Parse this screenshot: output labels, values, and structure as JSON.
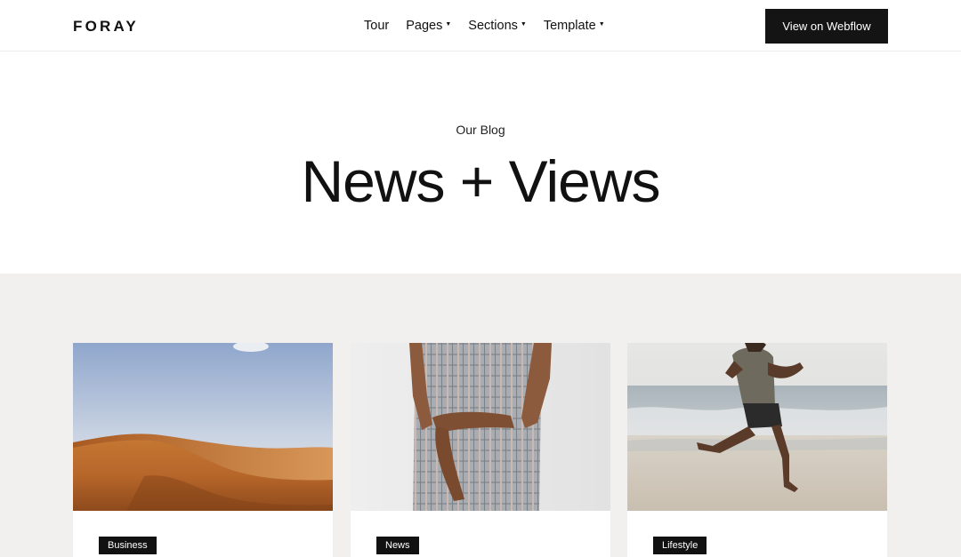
{
  "header": {
    "logo": "FORAY",
    "nav": [
      {
        "label": "Tour",
        "has_dropdown": false
      },
      {
        "label": "Pages",
        "has_dropdown": true
      },
      {
        "label": "Sections",
        "has_dropdown": true
      },
      {
        "label": "Template",
        "has_dropdown": true
      }
    ],
    "cta_label": "View on Webflow"
  },
  "hero": {
    "eyebrow": "Our Blog",
    "title": "News + Views"
  },
  "posts": [
    {
      "image": "desert-dunes-photo",
      "tag": "Business"
    },
    {
      "image": "plaid-dress-photo",
      "tag": "News"
    },
    {
      "image": "beach-runner-photo",
      "tag": "Lifestyle"
    }
  ],
  "colors": {
    "accent": "#141414",
    "section_bg": "#f1f0ee",
    "page_bg": "#ffffff"
  }
}
